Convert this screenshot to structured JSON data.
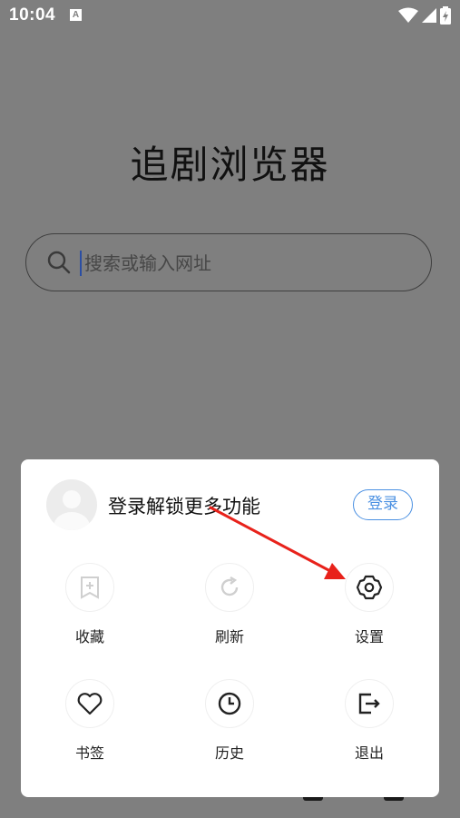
{
  "status_bar": {
    "time": "10:04",
    "app_icon_letter": "A",
    "icons": [
      "wifi-icon",
      "signal-icon",
      "battery-icon"
    ]
  },
  "home": {
    "title": "追剧浏览器",
    "search": {
      "placeholder": "搜索或输入网址",
      "icon": "search-icon"
    }
  },
  "menu": {
    "login_prompt": "登录解锁更多功能",
    "login_button": "登录",
    "items": [
      {
        "label": "收藏",
        "icon": "bookmark-add-icon",
        "enabled": false
      },
      {
        "label": "刷新",
        "icon": "refresh-icon",
        "enabled": false
      },
      {
        "label": "设置",
        "icon": "settings-icon",
        "enabled": true
      },
      {
        "label": "书签",
        "icon": "heart-icon",
        "enabled": true
      },
      {
        "label": "历史",
        "icon": "history-clock-icon",
        "enabled": true
      },
      {
        "label": "退出",
        "icon": "exit-icon",
        "enabled": true
      }
    ]
  },
  "annotation": {
    "type": "red-arrow",
    "points_to": "settings"
  },
  "colors": {
    "overlay": "#7f7f7f",
    "accent": "#4a90e2",
    "arrow": "#e8221b"
  }
}
